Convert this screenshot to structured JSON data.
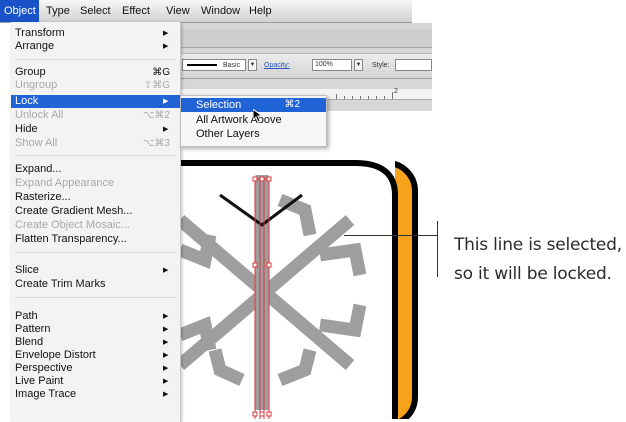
{
  "menubar": {
    "items": [
      "Object",
      "Type",
      "Select",
      "Effect",
      "View",
      "Window",
      "Help"
    ],
    "active_index": 0
  },
  "object_menu": {
    "items": [
      {
        "label": "Transform",
        "submenu": true,
        "enabled": true
      },
      {
        "label": "Arrange",
        "submenu": true,
        "enabled": true
      },
      {
        "label": "Group",
        "shortcut": "⌘G",
        "enabled": true
      },
      {
        "label": "Ungroup",
        "shortcut": "⇧⌘G",
        "enabled": false
      },
      {
        "label": "Lock",
        "submenu": true,
        "enabled": true,
        "highlighted": true
      },
      {
        "label": "Unlock All",
        "shortcut": "⌥⌘2",
        "enabled": false
      },
      {
        "label": "Hide",
        "submenu": true,
        "enabled": true
      },
      {
        "label": "Show All",
        "shortcut": "⌥⌘3",
        "enabled": false
      },
      {
        "label": "Expand...",
        "enabled": true
      },
      {
        "label": "Expand Appearance",
        "enabled": false
      },
      {
        "label": "Rasterize...",
        "enabled": true
      },
      {
        "label": "Create Gradient Mesh...",
        "enabled": true
      },
      {
        "label": "Create Object Mosaic...",
        "enabled": false
      },
      {
        "label": "Flatten Transparency...",
        "enabled": true
      },
      {
        "label": "Slice",
        "submenu": true,
        "enabled": true
      },
      {
        "label": "Create Trim Marks",
        "enabled": true
      },
      {
        "label": "Path",
        "submenu": true,
        "enabled": true
      },
      {
        "label": "Pattern",
        "submenu": true,
        "enabled": true
      },
      {
        "label": "Blend",
        "submenu": true,
        "enabled": true
      },
      {
        "label": "Envelope Distort",
        "submenu": true,
        "enabled": true
      },
      {
        "label": "Perspective",
        "submenu": true,
        "enabled": true
      },
      {
        "label": "Live Paint",
        "submenu": true,
        "enabled": true
      },
      {
        "label": "Image Trace",
        "submenu": true,
        "enabled": true
      }
    ]
  },
  "lock_submenu": {
    "items": [
      {
        "label": "Selection",
        "shortcut": "⌘2",
        "highlighted": true
      },
      {
        "label": "All Artwork Above"
      },
      {
        "label": "Other Layers"
      }
    ]
  },
  "control_bar": {
    "stroke_style": "Basic",
    "opacity_label": "Opacity:",
    "opacity_value": "100%",
    "style_label": "Style:",
    "ruler_mark": "2"
  },
  "callout": {
    "line1": "This line is selected,",
    "line2": "so it will be locked."
  },
  "colors": {
    "menu_highlight": "#1f63d6",
    "sign_border": "#000000",
    "sign_fill": "#f6a21a",
    "snowflake": "#9e9e9e",
    "selection": "#d9363e"
  },
  "icons": {
    "submenu_arrow": "triangle-right-icon",
    "cursor": "arrow-cursor-icon"
  }
}
